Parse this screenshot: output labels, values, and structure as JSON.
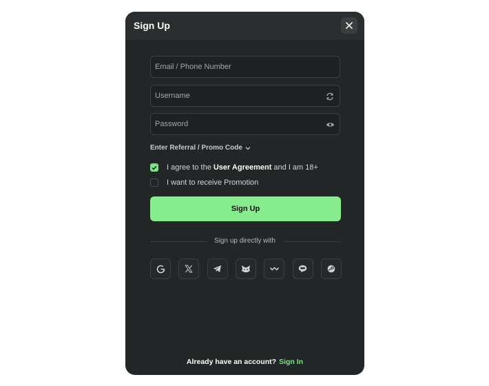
{
  "modal": {
    "title": "Sign Up"
  },
  "form": {
    "email_placeholder": "Email / Phone Number",
    "username_placeholder": "Username",
    "password_placeholder": "Password",
    "promo_toggle_label": "Enter Referral / Promo Code"
  },
  "agreement": {
    "prefix": "I agree to the",
    "link": "User Agreement",
    "suffix": "and I am 18+",
    "checked": true
  },
  "promotion": {
    "label": "I want to receive Promotion",
    "checked": false
  },
  "signup_button_label": "Sign Up",
  "divider_text": "Sign up directly with",
  "social": {
    "providers": [
      "google-icon",
      "x-icon",
      "telegram-icon",
      "metamask-icon",
      "walletconnect-icon",
      "line-icon",
      "steam-icon"
    ]
  },
  "footer": {
    "question": "Already have an account?",
    "signin_link": "Sign In"
  },
  "colors": {
    "accent": "#86ec8e",
    "modal_bg": "#232626",
    "link": "#7be389"
  }
}
